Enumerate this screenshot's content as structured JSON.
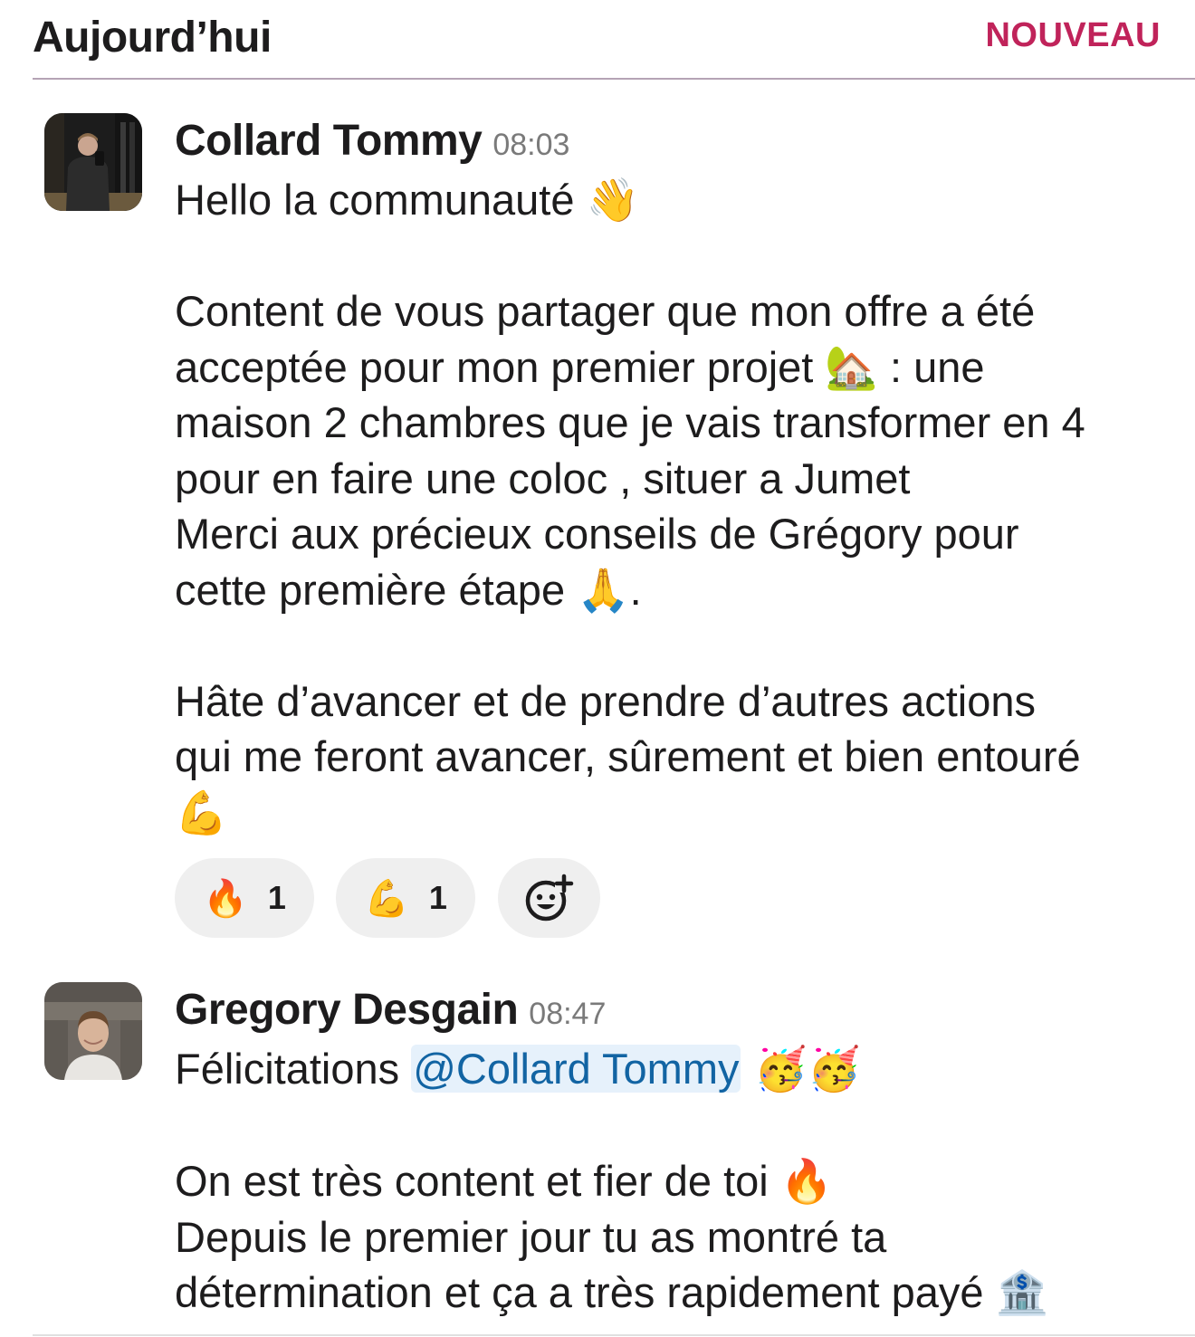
{
  "header": {
    "title": "Aujourd’hui",
    "new_label": "NOUVEAU"
  },
  "messages": [
    {
      "author": "Collard Tommy",
      "time": "08:03",
      "lines": [
        "Hello la communauté 👋",
        "",
        "Content de vous partager que mon offre a été",
        "acceptée pour mon premier projet 🏡 : une",
        "maison 2 chambres que je vais transformer en 4",
        "pour en faire une coloc , situer a Jumet",
        "Merci aux précieux conseils de Grégory pour",
        "cette première étape 🙏.",
        "",
        "Hâte d’avancer et de prendre d’autres actions",
        "qui me feront avancer, sûrement et bien entouré",
        "💪"
      ],
      "reactions": [
        {
          "emoji": "🔥",
          "count": "1"
        },
        {
          "emoji": "💪",
          "count": "1"
        }
      ],
      "add_reaction_icon": "add-reaction-icon"
    },
    {
      "author": "Gregory Desgain",
      "time": "08:47",
      "line1_prefix": "Félicitations ",
      "mention": "@Collard Tommy",
      "line1_suffix": " 🥳🥳",
      "lines": [
        "",
        "On est très content et fier de toi 🔥",
        "Depuis le premier jour tu as montré ta",
        "détermination et ça a très rapidement payé 🏦"
      ]
    }
  ],
  "colors": {
    "accent": "#c0235a",
    "mention_bg": "#e6f1fb",
    "mention_text": "#1264a3",
    "reaction_bg": "#efefef"
  }
}
